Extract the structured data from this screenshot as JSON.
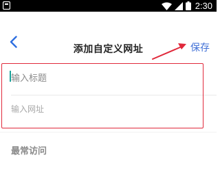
{
  "status_bar": {
    "time": "2:30",
    "icons": [
      "app-notification-icon",
      "wifi-icon",
      "cellular-signal-icon",
      "battery-icon"
    ]
  },
  "header": {
    "back_icon": "chevron-left-icon",
    "title": "添加自定义网址",
    "save_label": "保存"
  },
  "form": {
    "title_placeholder": "输入标题",
    "url_placeholder": "输入网址"
  },
  "section": {
    "label": "最常访问"
  },
  "colors": {
    "accent": "#3f6fd6",
    "annotation": "#e0283a",
    "cursor": "#1aa39a"
  }
}
